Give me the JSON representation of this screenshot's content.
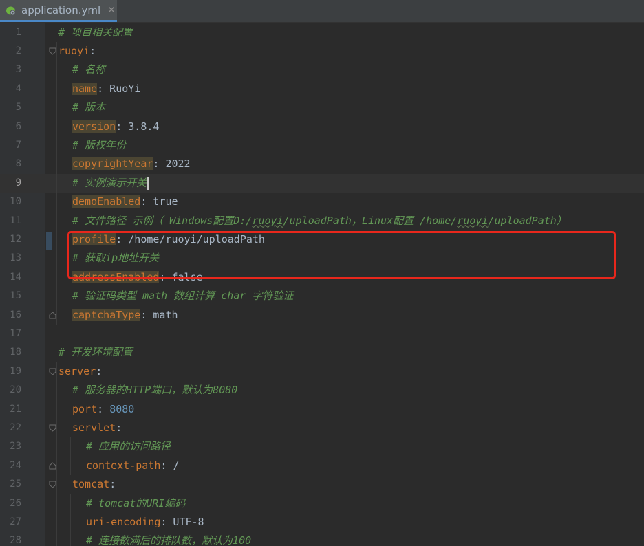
{
  "tab": {
    "label": "application.yml",
    "close": "✕",
    "icon": "spring-gear-icon"
  },
  "current_line": 9,
  "lines": [
    {
      "n": "1",
      "indent": 0,
      "parts": [
        {
          "t": "comment",
          "v": "# 项目相关配置"
        }
      ]
    },
    {
      "n": "2",
      "indent": 0,
      "fold": "open",
      "parts": [
        {
          "t": "key",
          "v": "ruoyi"
        },
        {
          "t": "plain",
          "v": ":"
        }
      ]
    },
    {
      "n": "3",
      "indent": 1,
      "parts": [
        {
          "t": "comment",
          "v": "# 名称"
        }
      ]
    },
    {
      "n": "4",
      "indent": 1,
      "parts": [
        {
          "t": "keyhl",
          "v": "name"
        },
        {
          "t": "plain",
          "v": ": RuoYi"
        }
      ]
    },
    {
      "n": "5",
      "indent": 1,
      "parts": [
        {
          "t": "comment",
          "v": "# 版本"
        }
      ]
    },
    {
      "n": "6",
      "indent": 1,
      "parts": [
        {
          "t": "keyhl",
          "v": "version"
        },
        {
          "t": "plain",
          "v": ": 3.8.4"
        }
      ]
    },
    {
      "n": "7",
      "indent": 1,
      "parts": [
        {
          "t": "comment",
          "v": "# 版权年份"
        }
      ]
    },
    {
      "n": "8",
      "indent": 1,
      "parts": [
        {
          "t": "keyhl",
          "v": "copyrightYear"
        },
        {
          "t": "plain",
          "v": ": 2022"
        }
      ]
    },
    {
      "n": "9",
      "indent": 1,
      "caret": true,
      "parts": [
        {
          "t": "comment",
          "v": "# 实例演示开关"
        }
      ]
    },
    {
      "n": "10",
      "indent": 1,
      "parts": [
        {
          "t": "keyhl",
          "v": "demoEnabled"
        },
        {
          "t": "plain",
          "v": ": true"
        }
      ]
    },
    {
      "n": "11",
      "indent": 1,
      "parts": [
        {
          "t": "comment",
          "v": "# 文件路径 示例（ Windows配置D:/"
        },
        {
          "t": "commentsq",
          "v": "ruoyi"
        },
        {
          "t": "comment",
          "v": "/uploadPath，Linux配置 /home/"
        },
        {
          "t": "commentsq",
          "v": "ruoyi"
        },
        {
          "t": "comment",
          "v": "/uploadPath）"
        }
      ]
    },
    {
      "n": "12",
      "indent": 1,
      "parts": [
        {
          "t": "keyhl",
          "v": "profile"
        },
        {
          "t": "plain",
          "v": ": /home/ruoyi/uploadPath"
        }
      ]
    },
    {
      "n": "13",
      "indent": 1,
      "parts": [
        {
          "t": "comment",
          "v": "# 获取ip地址开关"
        }
      ]
    },
    {
      "n": "14",
      "indent": 1,
      "parts": [
        {
          "t": "keyhl",
          "v": "addressEnabled"
        },
        {
          "t": "plain",
          "v": ": false"
        }
      ]
    },
    {
      "n": "15",
      "indent": 1,
      "parts": [
        {
          "t": "comment",
          "v": "# 验证码类型 math 数组计算 char 字符验证"
        }
      ]
    },
    {
      "n": "16",
      "indent": 1,
      "fold": "end",
      "parts": [
        {
          "t": "keyhl",
          "v": "captchaType"
        },
        {
          "t": "plain",
          "v": ": math"
        }
      ]
    },
    {
      "n": "17",
      "indent": 0,
      "parts": []
    },
    {
      "n": "18",
      "indent": 0,
      "parts": [
        {
          "t": "comment",
          "v": "# 开发环境配置"
        }
      ]
    },
    {
      "n": "19",
      "indent": 0,
      "fold": "open",
      "parts": [
        {
          "t": "key",
          "v": "server"
        },
        {
          "t": "plain",
          "v": ":"
        }
      ]
    },
    {
      "n": "20",
      "indent": 1,
      "parts": [
        {
          "t": "comment",
          "v": "# 服务器的HTTP端口，默认为8080"
        }
      ]
    },
    {
      "n": "21",
      "indent": 1,
      "parts": [
        {
          "t": "key",
          "v": "port"
        },
        {
          "t": "plain",
          "v": ": "
        },
        {
          "t": "num",
          "v": "8080"
        }
      ]
    },
    {
      "n": "22",
      "indent": 1,
      "fold": "open",
      "parts": [
        {
          "t": "key",
          "v": "servlet"
        },
        {
          "t": "plain",
          "v": ":"
        }
      ]
    },
    {
      "n": "23",
      "indent": 2,
      "parts": [
        {
          "t": "comment",
          "v": "# 应用的访问路径"
        }
      ]
    },
    {
      "n": "24",
      "indent": 2,
      "fold": "end",
      "parts": [
        {
          "t": "key",
          "v": "context-path"
        },
        {
          "t": "plain",
          "v": ": /"
        }
      ]
    },
    {
      "n": "25",
      "indent": 1,
      "fold": "open",
      "parts": [
        {
          "t": "key",
          "v": "tomcat"
        },
        {
          "t": "plain",
          "v": ":"
        }
      ]
    },
    {
      "n": "26",
      "indent": 2,
      "parts": [
        {
          "t": "comment",
          "v": "# tomcat的URI编码"
        }
      ]
    },
    {
      "n": "27",
      "indent": 2,
      "parts": [
        {
          "t": "key",
          "v": "uri-encoding"
        },
        {
          "t": "plain",
          "v": ": UTF-8"
        }
      ]
    },
    {
      "n": "28",
      "indent": 2,
      "parts": [
        {
          "t": "comment",
          "v": "# 连接数满后的排队数，默认为100"
        }
      ]
    }
  ],
  "colors": {
    "comment": "#629755",
    "key": "#cc7832",
    "number": "#6897bb",
    "highlight_box": "#e8271c"
  }
}
